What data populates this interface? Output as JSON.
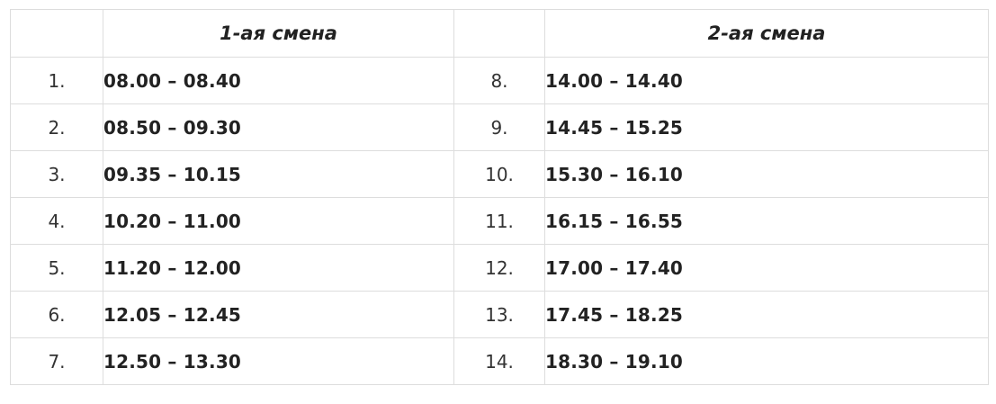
{
  "header": {
    "shift1": "1-ая смена",
    "shift2": "2-ая смена"
  },
  "rows": [
    {
      "num1": "1.",
      "time1": "08.00 – 08.40",
      "num2": "8.",
      "time2": "14.00 – 14.40"
    },
    {
      "num1": "2.",
      "time1": "08.50 – 09.30",
      "num2": "9.",
      "time2": "14.45 – 15.25"
    },
    {
      "num1": "3.",
      "time1": "09.35 – 10.15",
      "num2": "10.",
      "time2": "15.30 – 16.10"
    },
    {
      "num1": "4.",
      "time1": "10.20 – 11.00",
      "num2": "11.",
      "time2": "16.15 – 16.55"
    },
    {
      "num1": "5.",
      "time1": "11.20 – 12.00",
      "num2": "12.",
      "time2": "17.00 – 17.40"
    },
    {
      "num1": "6.",
      "time1": "12.05 – 12.45",
      "num2": "13.",
      "time2": "17.45 – 18.25"
    },
    {
      "num1": "7.",
      "time1": "12.50 – 13.30",
      "num2": "14.",
      "time2": "18.30 – 19.10"
    }
  ]
}
